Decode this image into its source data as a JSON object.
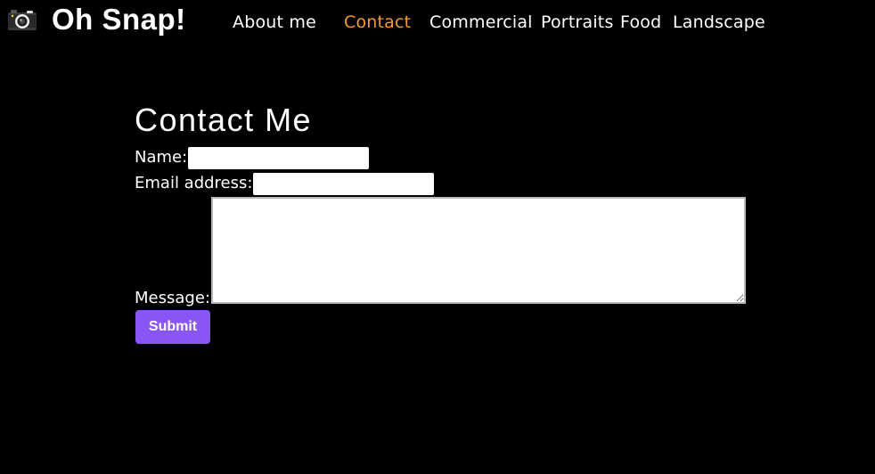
{
  "brand": {
    "title": "Oh Snap!",
    "icon": "camera-icon"
  },
  "nav": {
    "items": [
      {
        "label": "About me",
        "active": false
      },
      {
        "label": "Contact",
        "active": true
      },
      {
        "label": "Commercial",
        "active": false
      },
      {
        "label": "Portraits",
        "active": false
      },
      {
        "label": "Food",
        "active": false
      },
      {
        "label": "Landscape",
        "active": false
      }
    ],
    "active_color": "#f59a2e"
  },
  "contact": {
    "heading": "Contact Me",
    "name_label": "Name:",
    "name_value": "",
    "email_label": "Email address:",
    "email_value": "",
    "message_label": "Message:",
    "message_value": "",
    "submit_label": "Submit"
  },
  "colors": {
    "background": "#000000",
    "button": "#8a55f7",
    "text": "#ffffff"
  }
}
